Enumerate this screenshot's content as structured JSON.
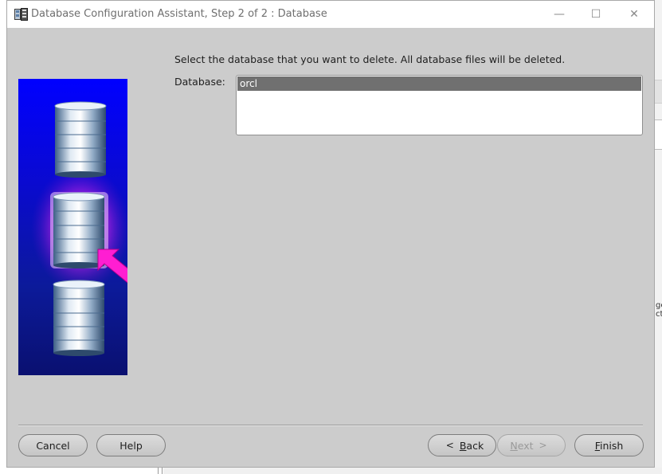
{
  "window": {
    "title": "Database Configuration Assistant, Step 2 of 2 : Database",
    "controls": {
      "minimize": "—",
      "maximize": "☐",
      "close": "✕"
    }
  },
  "main": {
    "instruction": "Select the database that you want to delete. All database files will be deleted.",
    "database_label": "Database:",
    "databases": [
      {
        "name": "orcl",
        "selected": true
      }
    ]
  },
  "buttons": {
    "cancel": "Cancel",
    "help": "Help",
    "back_mnemonic": "B",
    "back_rest": "ack",
    "next_mnemonic": "N",
    "next_rest": "ext",
    "finish_mnemonic": "F",
    "finish_rest": "inish",
    "back_arrow": "<",
    "next_arrow": ">"
  },
  "background": {
    "fragment_line1": "ge",
    "fragment_line2": "ct"
  },
  "icons": {
    "app": "database-configuration-icon",
    "illustration": "database-cylinders-with-pointer-arrow"
  },
  "colors": {
    "dialog_bg": "#cccccc",
    "selection": "#707070",
    "illustration_blue": "#0a0ad8",
    "arrow_magenta": "#ff1ed2"
  },
  "state": {
    "next_enabled": false
  }
}
